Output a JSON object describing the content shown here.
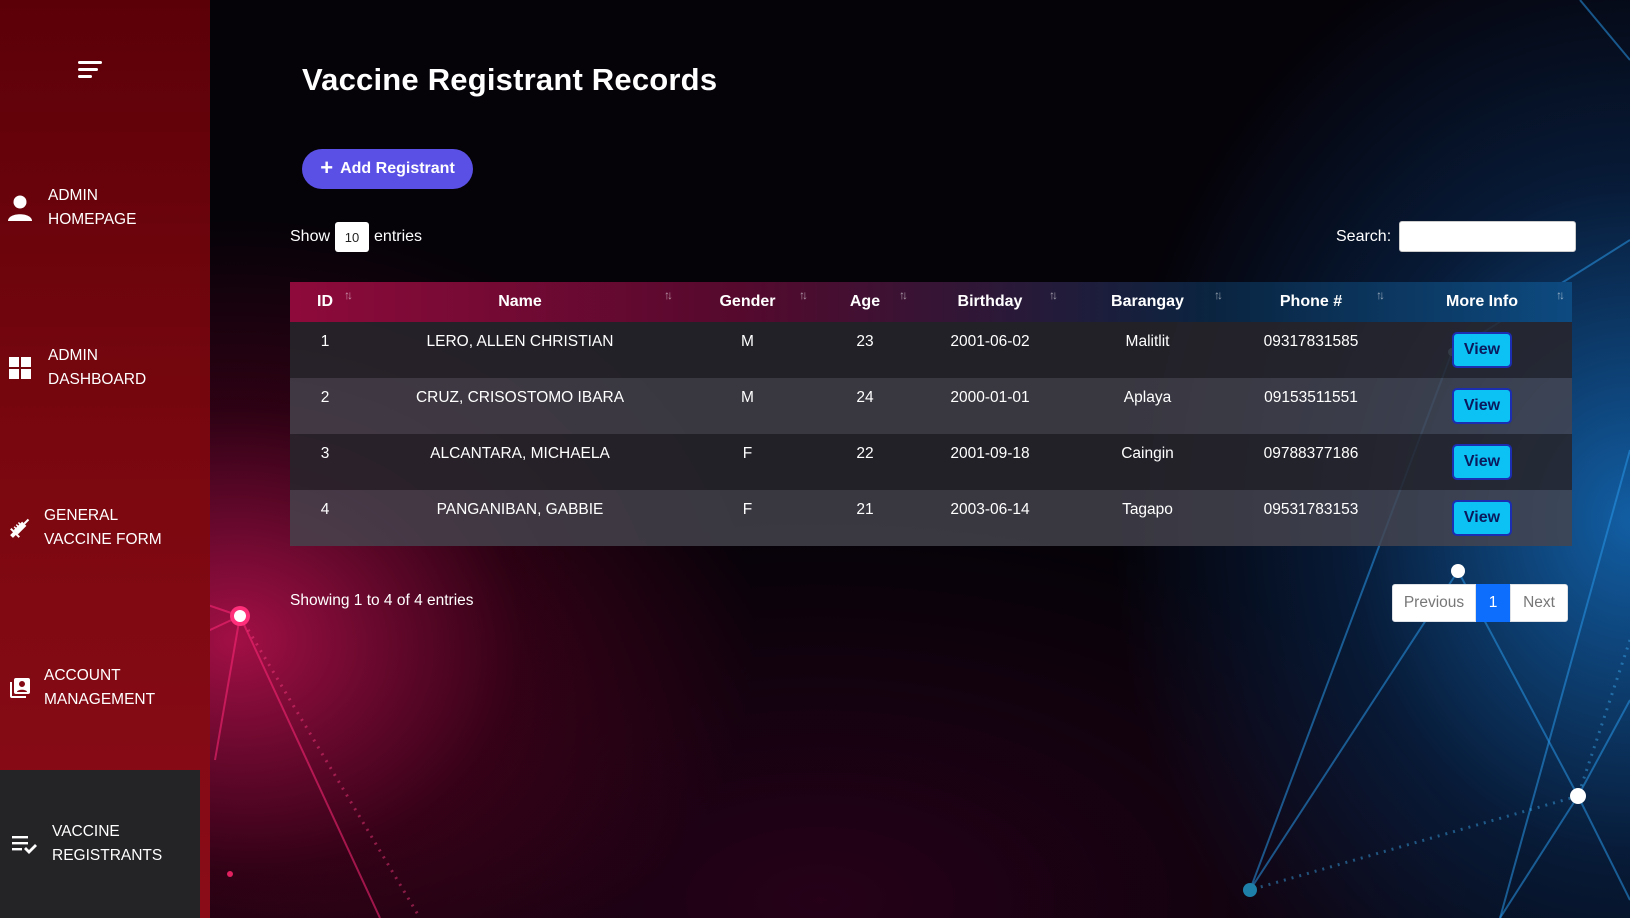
{
  "colors": {
    "sidebar": "#6e0510",
    "sidebar_active": "#242326",
    "accent_button": "#5b50e6",
    "view_button": "#0cc2f4",
    "pager_active": "#0d6efd"
  },
  "sidebar": {
    "toggle_icon": "hamburger-menu-icon",
    "items": [
      {
        "label_line1": "ADMIN",
        "label_line2": "HOMEPAGE",
        "icon": "user-icon"
      },
      {
        "label_line1": "ADMIN",
        "label_line2": "DASHBOARD",
        "icon": "grid-icon"
      },
      {
        "label_line1": "GENERAL",
        "label_line2": "VACCINE FORM",
        "icon": "syringe-icon"
      },
      {
        "label_line1": "ACCOUNT",
        "label_line2": "MANAGEMENT",
        "icon": "account-box-icon"
      },
      {
        "label_line1": "VACCINE",
        "label_line2": "REGISTRANTS",
        "icon": "playlist-check-icon",
        "active": true
      }
    ]
  },
  "main": {
    "title": "Vaccine Registrant Records",
    "add_button_label": "Add Registrant",
    "show_label": "Show",
    "entries_value": "10",
    "entries_label": "entries",
    "search_label": "Search:",
    "search_value": "",
    "columns": [
      "ID",
      "Name",
      "Gender",
      "Age",
      "Birthday",
      "Barangay",
      "Phone #",
      "More Info"
    ],
    "rows": [
      {
        "id": "1",
        "name": "LERO, ALLEN CHRISTIAN",
        "gender": "M",
        "age": "23",
        "birthday": "2001-06-02",
        "barangay": "Malitlit",
        "phone": "09317831585",
        "action": "View"
      },
      {
        "id": "2",
        "name": "CRUZ, CRISOSTOMO IBARA",
        "gender": "M",
        "age": "24",
        "birthday": "2000-01-01",
        "barangay": "Aplaya",
        "phone": "09153511551",
        "action": "View"
      },
      {
        "id": "3",
        "name": "ALCANTARA, MICHAELA",
        "gender": "F",
        "age": "22",
        "birthday": "2001-09-18",
        "barangay": "Caingin",
        "phone": "09788377186",
        "action": "View"
      },
      {
        "id": "4",
        "name": "PANGANIBAN, GABBIE",
        "gender": "F",
        "age": "21",
        "birthday": "2003-06-14",
        "barangay": "Tagapo",
        "phone": "09531783153",
        "action": "View"
      }
    ],
    "info_text": "Showing 1 to 4 of 4 entries",
    "pagination": {
      "previous": "Previous",
      "current": "1",
      "next": "Next"
    }
  }
}
